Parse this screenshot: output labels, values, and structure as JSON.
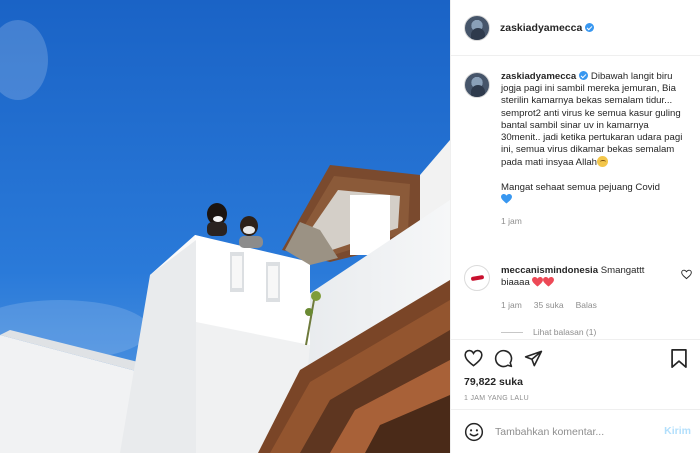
{
  "post": {
    "username": "zaskiadyamecca",
    "caption": "Dibawah langit biru jogja pagi ini sambil mereka jemuran, Bia sterilin kamarnya bekas semalam tidur... semprot2 anti virus ke semua kasur guling bantal sambil sinar uv in kamarnya 30menit.. jadi ketika pertukaran udara pagi ini, semua virus dikamar bekas semalam pada mati insyaa Allah",
    "caption_extra": "Mangat sehaat semua pejuang Covid",
    "caption_time": "1 jam"
  },
  "comment": {
    "username": "meccanismindonesia",
    "text": "Smangattt biaaaa",
    "time": "1 jam",
    "likes": "35 suka",
    "reply": "Balas",
    "view_replies": "Lihat balasan (1)"
  },
  "actions": {
    "likes": "79,822 suka",
    "posted": "1 JAM YANG LALU"
  },
  "add_comment": {
    "placeholder": "Tambahkan komentar...",
    "post_label": "Kirim"
  },
  "icons": {
    "like": "heart-icon",
    "comment": "comment-icon",
    "share": "paper-plane-icon",
    "save": "bookmark-icon",
    "emoji": "smiley-icon",
    "verified": "verified-badge-icon"
  },
  "colors": {
    "verified": "#3897f0",
    "sky": "#1f6dd0",
    "heart_red": "#ed4956",
    "heart_blue": "#3897f0",
    "post_button": "#b2dffc"
  }
}
